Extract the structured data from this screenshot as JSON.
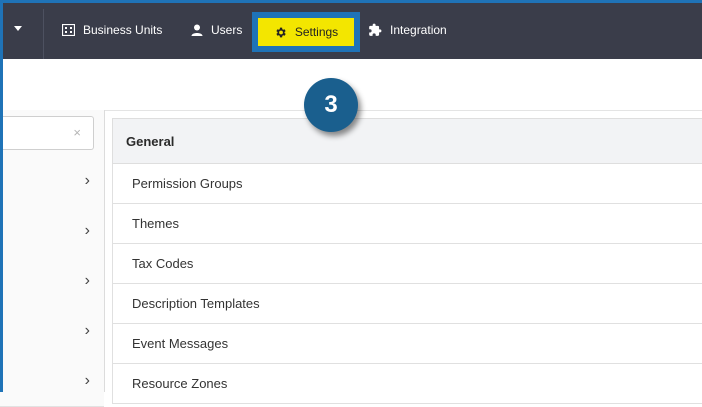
{
  "topnav": {
    "items": [
      {
        "label": "Business Units",
        "icon": "building-icon"
      },
      {
        "label": "Users",
        "icon": "user-icon"
      },
      {
        "label": "Settings",
        "icon": "gear-icon"
      },
      {
        "label": "Integration",
        "icon": "puzzle-icon"
      }
    ],
    "highlight_color": "#f3e600",
    "highlight_border": "#1f73b7"
  },
  "step_badge": "3",
  "left_panel": {
    "search": {
      "value": "",
      "clear_icon": "×"
    }
  },
  "settings_list": {
    "header": "General",
    "items": [
      "Permission Groups",
      "Themes",
      "Tax Codes",
      "Description Templates",
      "Event Messages",
      "Resource Zones"
    ]
  },
  "colors": {
    "topbar": "#3a3d4a",
    "badge": "#1a5f8e"
  }
}
